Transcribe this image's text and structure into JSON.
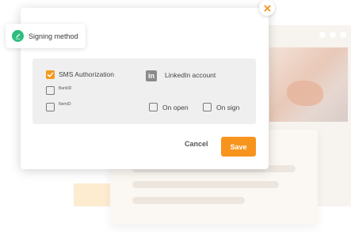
{
  "tag": {
    "icon": "pen-icon",
    "label": "Signing method"
  },
  "options": {
    "sms": {
      "label": "SMS Authorization",
      "checked": true
    },
    "bankid": {
      "label": "BankID",
      "checked": false
    },
    "nemid": {
      "label": "NemID",
      "checked": false
    },
    "linkedin": {
      "label": "LinkedIn account",
      "icon": "linkedin-icon",
      "icon_glyph": "in"
    },
    "on_open": {
      "label": "On open",
      "checked": false
    },
    "on_sign": {
      "label": "On sign",
      "checked": false
    }
  },
  "actions": {
    "cancel_label": "Cancel",
    "save_label": "Save"
  },
  "colors": {
    "accent": "#f7941d",
    "check": "#f49a1c",
    "tag_icon": "#2ebd7f",
    "close_icon": "#f7941d"
  }
}
